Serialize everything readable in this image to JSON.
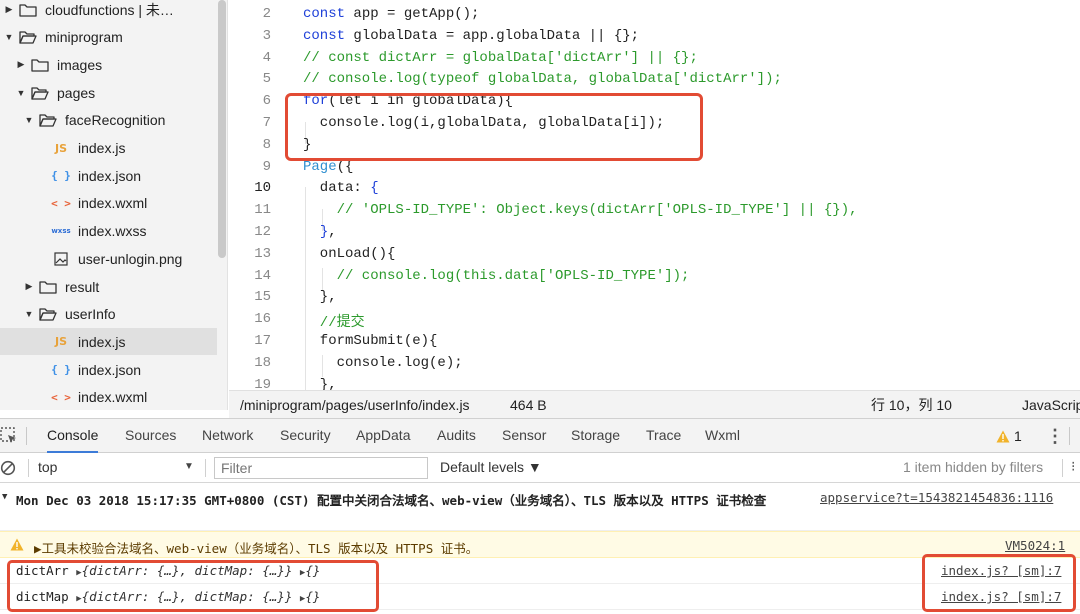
{
  "file_tree": [
    {
      "label": "cloudfunctions | 未…",
      "type": "folder",
      "expanded": false,
      "depth": 0
    },
    {
      "label": "miniprogram",
      "type": "folder",
      "expanded": true,
      "depth": 0
    },
    {
      "label": "images",
      "type": "folder",
      "expanded": false,
      "depth": 1
    },
    {
      "label": "pages",
      "type": "folder",
      "expanded": true,
      "depth": 1
    },
    {
      "label": "faceRecognition",
      "type": "folder",
      "expanded": true,
      "depth": 2
    },
    {
      "label": "index.js",
      "type": "js",
      "depth": 3
    },
    {
      "label": "index.json",
      "type": "json",
      "depth": 3
    },
    {
      "label": "index.wxml",
      "type": "wxml",
      "depth": 3
    },
    {
      "label": "index.wxss",
      "type": "wxss",
      "depth": 3
    },
    {
      "label": "user-unlogin.png",
      "type": "image",
      "depth": 3
    },
    {
      "label": "result",
      "type": "folder",
      "expanded": false,
      "depth": 2
    },
    {
      "label": "userInfo",
      "type": "folder",
      "expanded": true,
      "depth": 2
    },
    {
      "label": "index.js",
      "type": "js",
      "depth": 3,
      "selected": true
    },
    {
      "label": "index.json",
      "type": "json",
      "depth": 3
    },
    {
      "label": "index.wxml",
      "type": "wxml",
      "depth": 3
    }
  ],
  "file_icons": {
    "js": "JS",
    "json": "{ }",
    "wxml": "< >",
    "wxss": "wxss"
  },
  "editor": {
    "current_line": 10,
    "lines": [
      {
        "num": "2",
        "parts": [
          [
            "kw",
            "const"
          ],
          [
            "",
            "app = getApp();"
          ]
        ]
      },
      {
        "num": "3",
        "parts": [
          [
            "kw",
            "const"
          ],
          [
            "",
            "globalData = app.globalData || {};"
          ]
        ]
      },
      {
        "num": "4",
        "parts": [
          [
            "cm",
            "// const dictArr = globalData['dictArr'] || {};"
          ]
        ]
      },
      {
        "num": "5",
        "parts": [
          [
            "cm",
            "// console.log(typeof globalData, globalData['dictArr']);"
          ]
        ]
      },
      {
        "num": "6",
        "parts": [
          [
            "kw",
            "for"
          ],
          [
            "",
            "(let i in globalData){"
          ]
        ]
      },
      {
        "num": "7",
        "parts": [
          [
            "",
            "  console.log(i,globalData, globalData[i]);"
          ]
        ]
      },
      {
        "num": "8",
        "parts": [
          [
            "",
            "}"
          ]
        ]
      },
      {
        "num": "9",
        "parts": [
          [
            "pg",
            "Page"
          ],
          [
            "",
            "({"
          ]
        ]
      },
      {
        "num": "10",
        "parts": [
          [
            "",
            "  data: "
          ],
          [
            "brk",
            "{"
          ]
        ]
      },
      {
        "num": "11",
        "parts": [
          [
            "cm",
            "    // 'OPLS-ID_TYPE': Object.keys(dictArr['OPLS-ID_TYPE'] || {}),"
          ]
        ]
      },
      {
        "num": "12",
        "parts": [
          [
            "",
            "  "
          ],
          [
            "brk",
            "}"
          ],
          [
            "",
            ","
          ]
        ]
      },
      {
        "num": "13",
        "parts": [
          [
            "",
            "  onLoad(){"
          ]
        ]
      },
      {
        "num": "14",
        "parts": [
          [
            "cm",
            "    // console.log(this.data['OPLS-ID_TYPE']);"
          ]
        ]
      },
      {
        "num": "15",
        "parts": [
          [
            "",
            "  },"
          ]
        ]
      },
      {
        "num": "16",
        "parts": [
          [
            "cm",
            "  //提交"
          ]
        ]
      },
      {
        "num": "17",
        "parts": [
          [
            "",
            "  formSubmit(e){"
          ]
        ]
      },
      {
        "num": "18",
        "parts": [
          [
            "",
            "    console.log(e);"
          ]
        ]
      },
      {
        "num": "19",
        "parts": [
          [
            "",
            "  },"
          ]
        ]
      }
    ]
  },
  "status_bar": {
    "path": "/miniprogram/pages/userInfo/index.js",
    "size": "464 B",
    "position": "行 10，列 10",
    "language": "JavaScript"
  },
  "devtools": {
    "tabs": [
      "Console",
      "Sources",
      "Network",
      "Security",
      "AppData",
      "Audits",
      "Sensor",
      "Storage",
      "Trace",
      "Wxml"
    ],
    "active_tab": "Console",
    "warning_count": "1"
  },
  "console_filter": {
    "context": "top",
    "filter_placeholder": "Filter",
    "levels": "Default levels ▼",
    "hidden_note": "1 item hidden by filters"
  },
  "console_messages": {
    "group_text": "Mon Dec 03 2018 15:17:35 GMT+0800 (CST) 配置中关闭合法域名、web-view（业务域名）、TLS 版本以及 HTTPS 证书检查",
    "group_source": "appservice?t=1543821454836:1116",
    "warning_text": "▶工具未校验合法域名、web-view（业务域名）、TLS 版本以及 HTTPS 证书。",
    "warning_source": "VM5024:1",
    "logs": [
      {
        "name": "dictArr",
        "value": "{dictArr: {…}, dictMap: {…}}",
        "extra": "{}",
        "source": "index.js? [sm]:7"
      },
      {
        "name": "dictMap",
        "value": "{dictArr: {…}, dictMap: {…}}",
        "extra": "{}",
        "source": "index.js? [sm]:7"
      }
    ]
  },
  "colors": {
    "keyword": "#1d3fd8",
    "comment": "#2c9a2c",
    "highlight_box": "#e24b34",
    "active_tab_underline": "#3c7bd8",
    "warning_bg": "#fffbe5"
  }
}
